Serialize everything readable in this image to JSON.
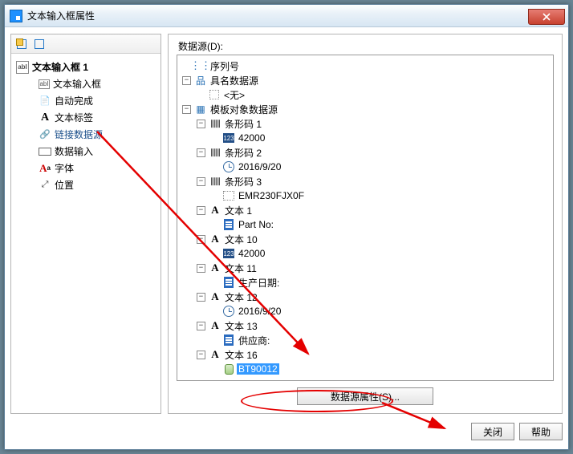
{
  "window": {
    "title": "文本输入框属性"
  },
  "left": {
    "root": "文本输入框 1",
    "items": [
      {
        "label": "文本输入框"
      },
      {
        "label": "自动完成"
      },
      {
        "label": "文本标签"
      },
      {
        "label": "链接数据源"
      },
      {
        "label": "数据输入"
      },
      {
        "label": "字体"
      },
      {
        "label": "位置"
      }
    ]
  },
  "right": {
    "data_source_label": "数据源(D):",
    "tree": {
      "seq": "序列号",
      "named": "具名数据源",
      "none": "<无>",
      "tmpl": "模板对象数据源",
      "bar1": "条形码 1",
      "bar1v": "42000",
      "bar2": "条形码 2",
      "bar2v": "2016/9/20",
      "bar3": "条形码 3",
      "bar3v": "EMR230FJX0F",
      "t1": "文本 1",
      "t1v": "Part No:",
      "t10": "文本 10",
      "t10v": "42000",
      "t11": "文本 11",
      "t11v": "生产日期:",
      "t12": "文本 12",
      "t12v": "2016/9/20",
      "t13": "文本 13",
      "t13v": "供应商:",
      "t16": "文本 16",
      "t16v": "BT90012"
    },
    "prop_button": "数据源属性(S)..."
  },
  "footer": {
    "close": "关闭",
    "help": "帮助"
  }
}
